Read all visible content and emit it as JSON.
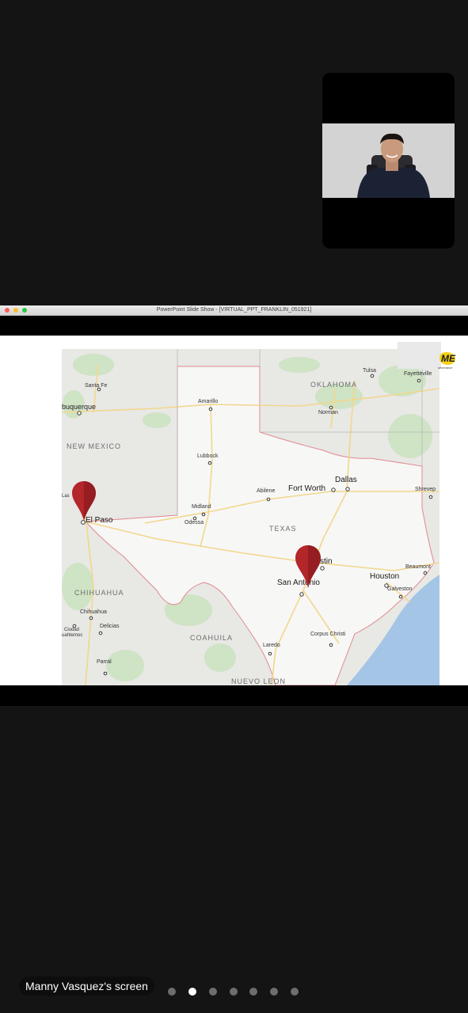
{
  "window": {
    "title": "PowerPoint Slide Show - [VIRTUAL_PPT_FRANKLIN_051921]"
  },
  "logo": {
    "mark": "ME",
    "sub": "severance"
  },
  "map": {
    "states": [
      "OKLAHOMA",
      "NEW MEXICO",
      "TEXAS",
      "CHIHUAHUA",
      "COAHUILA",
      "NUEVO LEON"
    ],
    "cities": {
      "santa_fe": "Santa Fe",
      "albuquerque": "buquerque",
      "amarillo": "Amarillo",
      "lubbock": "Lubbock",
      "tulsa": "Tulsa",
      "fayetteville": "Fayetteville",
      "norman": "Norman",
      "las": "Las",
      "el_paso": "El Paso",
      "midland": "Midland",
      "odessa": "Odessa",
      "abilene": "Abilene",
      "fort_worth": "Fort Worth",
      "dallas": "Dallas",
      "shreveport": "Shrevep",
      "austin": "stin",
      "san_antonio": "San Antonio",
      "houston": "Houston",
      "beaumont": "Beaumont",
      "galveston": "Galveston",
      "chihuahua": "Chihuahua",
      "delicias": "Delicias",
      "ciudad": "Ciudad",
      "cuauhtemoc": "uahtemoc",
      "parral": "Parral",
      "corpus_christi": "Corpus Christi",
      "laredo": "Laredo"
    },
    "markers": [
      "El Paso",
      "San Antonio"
    ],
    "marker_color": "#b3262a"
  },
  "footer": {
    "screen_label": "Manny Vasquez's screen",
    "page_count": 7,
    "active_page": 2
  }
}
